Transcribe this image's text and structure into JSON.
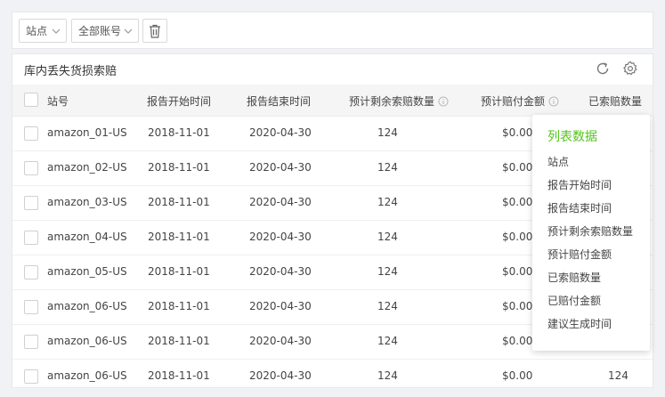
{
  "toolbar": {
    "site_select": "站点",
    "account_select": "全部账号",
    "delete_icon": "trash-icon"
  },
  "panel": {
    "title": "库内丢失货损索赔",
    "refresh_icon": "refresh-icon",
    "settings_icon": "gear-icon"
  },
  "table": {
    "headers": [
      "站号",
      "报告开始时间",
      "报告结束时间",
      "预计剩余索赔数量",
      "预计赔付金额",
      "已索赔数量"
    ],
    "rows": [
      {
        "site": "amazon_01-US",
        "start": "2018-11-01",
        "end": "2020-04-30",
        "remaining": "124",
        "amount": "$0.00",
        "claimed": ""
      },
      {
        "site": "amazon_02-US",
        "start": "2018-11-01",
        "end": "2020-04-30",
        "remaining": "124",
        "amount": "$0.00",
        "claimed": ""
      },
      {
        "site": "amazon_03-US",
        "start": "2018-11-01",
        "end": "2020-04-30",
        "remaining": "124",
        "amount": "$0.00",
        "claimed": ""
      },
      {
        "site": "amazon_04-US",
        "start": "2018-11-01",
        "end": "2020-04-30",
        "remaining": "124",
        "amount": "$0.00",
        "claimed": ""
      },
      {
        "site": "amazon_05-US",
        "start": "2018-11-01",
        "end": "2020-04-30",
        "remaining": "124",
        "amount": "$0.00",
        "claimed": ""
      },
      {
        "site": "amazon_06-US",
        "start": "2018-11-01",
        "end": "2020-04-30",
        "remaining": "124",
        "amount": "$0.00",
        "claimed": ""
      },
      {
        "site": "amazon_06-US",
        "start": "2018-11-01",
        "end": "2020-04-30",
        "remaining": "124",
        "amount": "$0.00",
        "claimed": ""
      },
      {
        "site": "amazon_06-US",
        "start": "2018-11-01",
        "end": "2020-04-30",
        "remaining": "124",
        "amount": "$0.00",
        "claimed": "124"
      }
    ]
  },
  "column_menu": {
    "title": "列表数据",
    "items": [
      "站点",
      "报告开始时间",
      "报告结束时间",
      "预计剩余索赔数量",
      "预计赔付金额",
      "已索赔数量",
      "已赔付金额",
      "建议生成时间"
    ]
  },
  "colors": {
    "accent_green": "#52c41a",
    "header_bg": "#f5f5f5",
    "page_bg": "#f0f2f5"
  }
}
